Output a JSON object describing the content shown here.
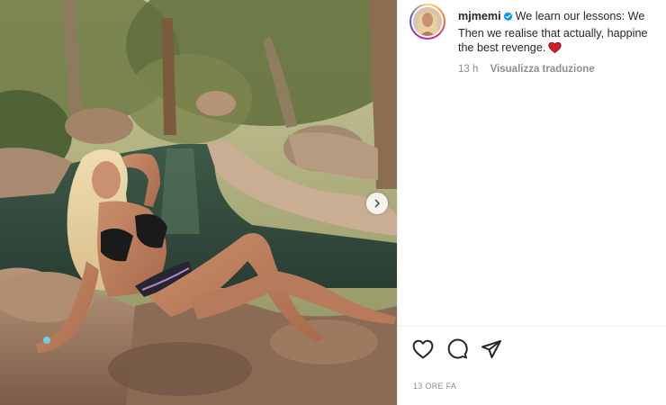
{
  "post": {
    "username": "mjmemi",
    "caption_lines": [
      "We learn our lessons: We",
      "Then we realise that actually, happine",
      "the best revenge."
    ],
    "time_ago": "13 h",
    "translate_label": "Visualizza traduzione",
    "timestamp": "13 ORE FA"
  },
  "icons": {
    "verified": "verified-badge-icon",
    "caption_emoji": "red-heart-icon",
    "like": "heart-outline-icon",
    "comment": "comment-bubble-icon",
    "share": "paper-plane-icon",
    "carousel_next": "chevron-right-icon"
  },
  "colors": {
    "verified_blue": "#0095f6",
    "heart_red": "#d71d2a",
    "meta_gray": "#8e8e8e",
    "text": "#262626"
  }
}
